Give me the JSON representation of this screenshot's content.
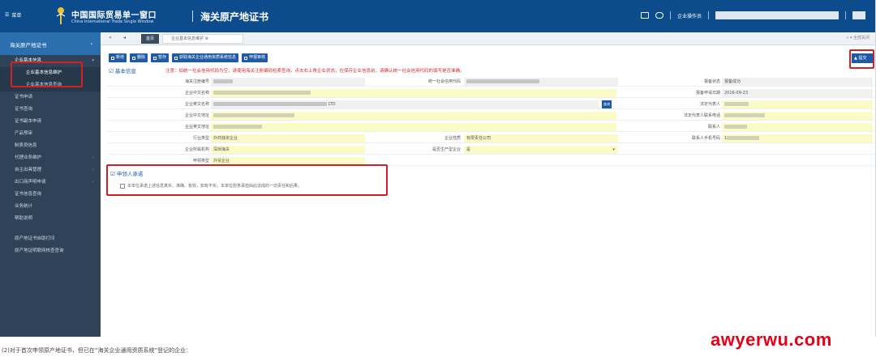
{
  "header": {
    "menu_label": "菜单",
    "logo_cn": "中国国际贸易单一窗口",
    "logo_en": "China International Trade Single Window",
    "system_title": "海关原产地证书",
    "user_label": "企业操作员"
  },
  "sidebar": {
    "module": "海关原产地证书",
    "items": [
      {
        "label": "企业基本信息",
        "type": "group"
      },
      {
        "label": "企业基本信息维护",
        "type": "sub",
        "active": true
      },
      {
        "label": "企业基本信息查询",
        "type": "sub"
      },
      {
        "label": "证书申请",
        "type": "item"
      },
      {
        "label": "证书查询",
        "type": "item"
      },
      {
        "label": "证书副本申请",
        "type": "item"
      },
      {
        "label": "产品预审",
        "type": "item"
      },
      {
        "label": "制表员信息",
        "type": "item"
      },
      {
        "label": "代理业务维护",
        "type": "item",
        "arrow": true
      },
      {
        "label": "自主出具管理",
        "type": "item",
        "arrow": true
      },
      {
        "label": "出口商声明申请",
        "type": "item",
        "arrow": true
      },
      {
        "label": "证书信息查询",
        "type": "item"
      },
      {
        "label": "业务统计",
        "type": "item"
      },
      {
        "label": "帮助说明",
        "type": "item"
      },
      {
        "label": "原产地证书自助打印",
        "type": "item",
        "gap": true
      },
      {
        "label": "原产地证明联网核查查询",
        "type": "item"
      }
    ]
  },
  "tabs": {
    "home": "首页",
    "current": "企业基本信息维护",
    "right": "全部关闭"
  },
  "toolbar": {
    "buttons": [
      "新增",
      "删除",
      "暂存",
      "获取海关企业通用资质系统信息",
      "申报审核"
    ],
    "save": "提交"
  },
  "basic": {
    "title": "基本信息",
    "notice": "注意：如统一社会信用代码为空，请使用海关注册编码检索查询，点击右上角企业状态，在保存企业信息前，请确认统一社会信用代码的填写是否准确。"
  },
  "form": {
    "labels": {
      "customs_code": "海关注册编号",
      "uscc": "统一社会信用代码",
      "status": "报备状态",
      "cn_name": "企业中文名称",
      "filing_date": "报备申请日期",
      "en_name": "企业英文名称",
      "legal_person": "法定代表人",
      "cn_address": "企业中文地址",
      "contact_phone": "法定代表人联系电话",
      "en_address": "企业英文地址",
      "industry": "行业类型",
      "ent_type": "企业性质",
      "contact": "联系人",
      "belong_org": "企业所属机构",
      "trade_type": "是否生产型企业",
      "contact_mobile": "联系人手机号码",
      "lang_signer": "申领类型"
    },
    "values": {
      "status": "报备成功",
      "filing_date": "2016-09-23",
      "en_address_tail": "LTD",
      "industry": "外商独资企业",
      "ent_type": "有限责任公司",
      "trade_type": "是",
      "belong_org": "深圳海关",
      "lang_signer": "外贸企业",
      "legal_mobile_prefix": "1"
    },
    "lookup_button": "查询"
  },
  "commit": {
    "title": "申领人承诺",
    "text": "本单位承诺上述信息真实、准确、有效，如有不实，本单位愿意承担由此造成的一切责任和后果。"
  },
  "caption": "(2)对于首次申领原产地证书，但已在“海关企业通用资质系统”登记的企业：",
  "watermark": "awyerwu.com",
  "colors": {
    "header_bg": "#0c4c8c",
    "sidebar_bg": "#2f4258",
    "accent": "#1e5aa5",
    "required_field": "#fbfbc8",
    "highlight": "#d32027"
  }
}
